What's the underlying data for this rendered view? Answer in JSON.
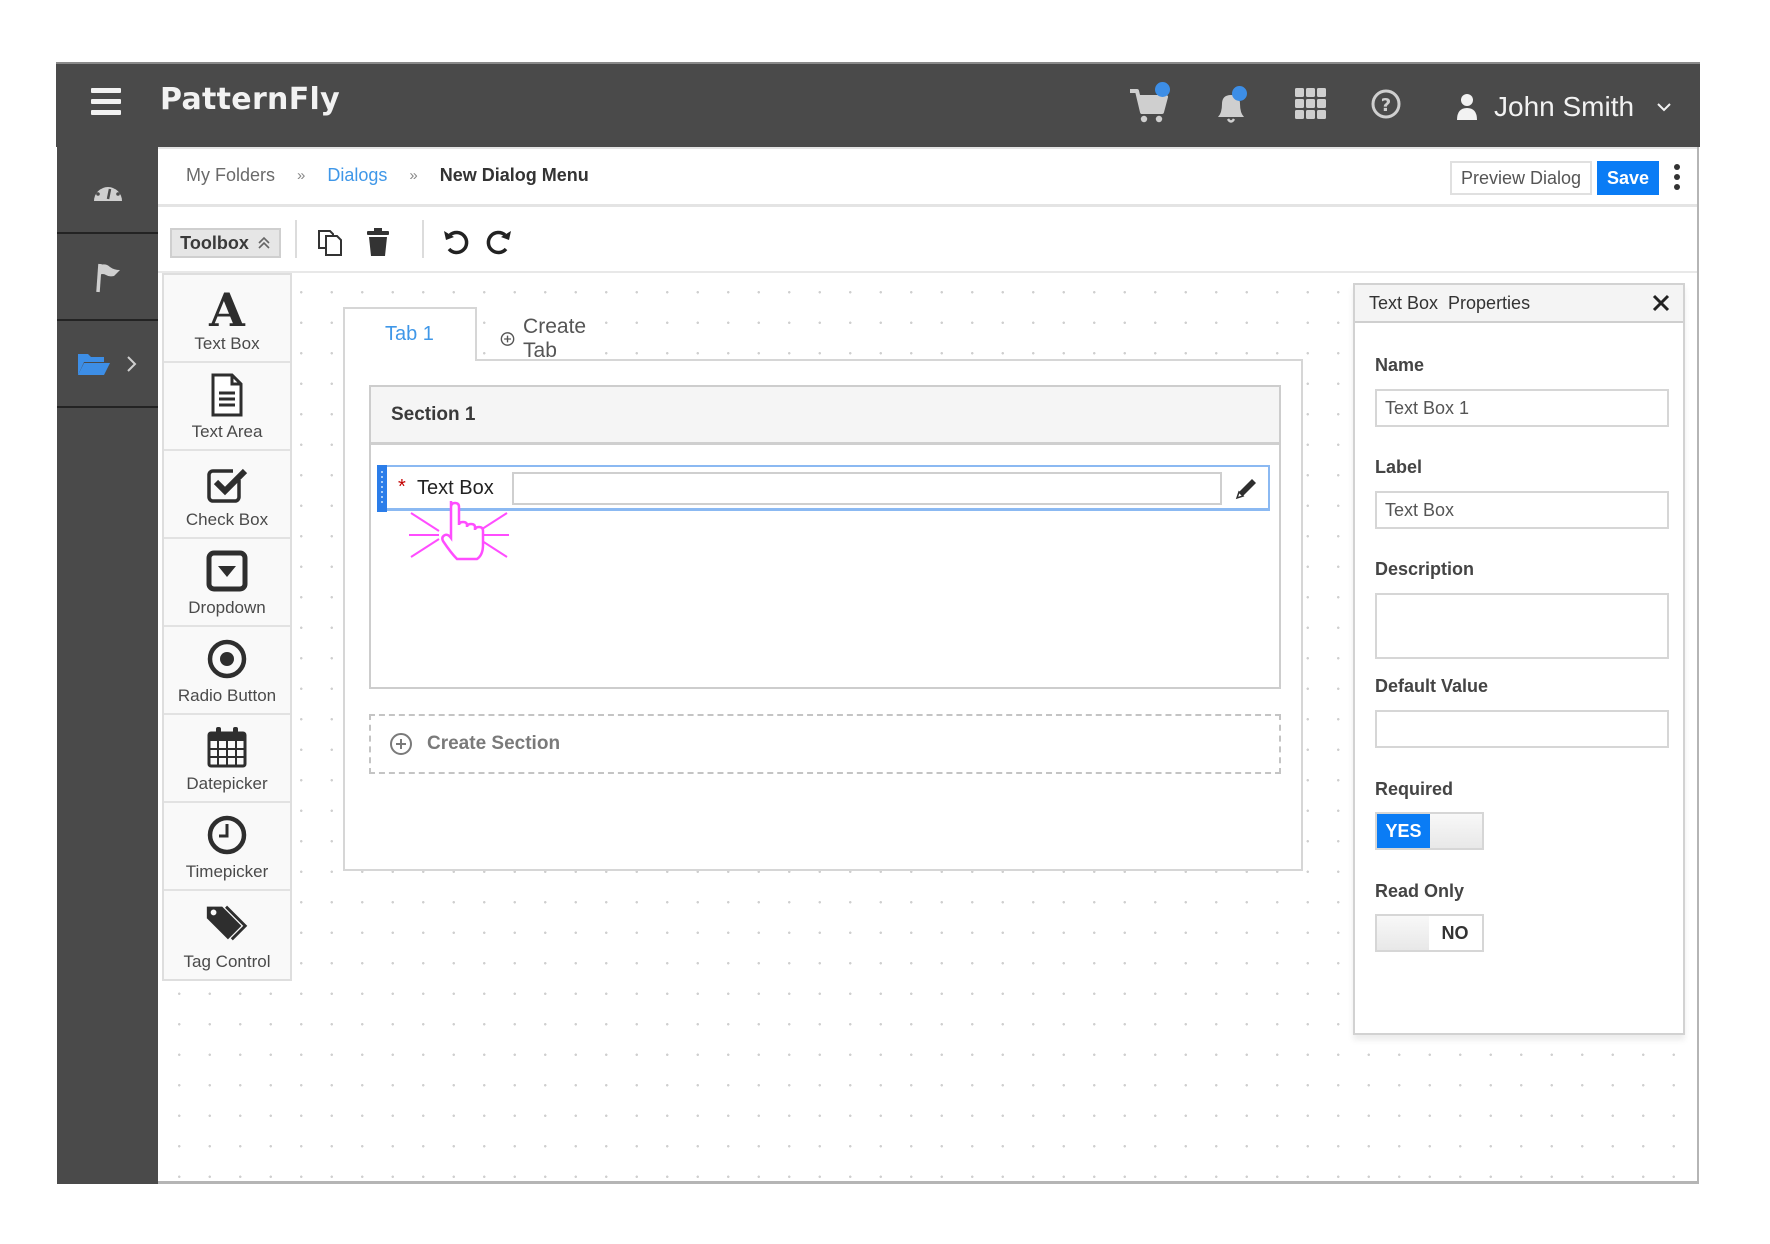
{
  "app": {
    "brand": "PatternFly",
    "user_name": "John Smith"
  },
  "header_icons": [
    {
      "name": "cart-icon",
      "has_badge": true
    },
    {
      "name": "bell-icon",
      "has_badge": true
    },
    {
      "name": "grid-icon",
      "has_badge": false
    },
    {
      "name": "help-icon",
      "has_badge": false
    }
  ],
  "colors": {
    "accent": "#0a7cf5",
    "link": "#3f97e8",
    "header_bg": "#4a4a4a",
    "badge": "#3d8ee6",
    "required": "#c40000",
    "cursor_highlight": "#ff33ff"
  },
  "sidebar": {
    "items": [
      {
        "icon": "dashboard-icon",
        "active": false
      },
      {
        "icon": "flag-icon",
        "active": false
      },
      {
        "icon": "folder-open-icon",
        "active": true,
        "has_submenu": true
      }
    ]
  },
  "breadcrumb": {
    "items": [
      "My Folders",
      "Dialogs",
      "New Dialog Menu"
    ],
    "separator": "»"
  },
  "actions": {
    "preview_label": "Preview Dialog",
    "save_label": "Save"
  },
  "toolbar": {
    "toolbox_label": "Toolbox"
  },
  "toolbox": {
    "items": [
      {
        "label": "Text Box",
        "icon": "text-box-icon"
      },
      {
        "label": "Text Area",
        "icon": "text-area-icon"
      },
      {
        "label": "Check Box",
        "icon": "check-box-icon"
      },
      {
        "label": "Dropdown",
        "icon": "dropdown-icon"
      },
      {
        "label": "Radio Button",
        "icon": "radio-button-icon"
      },
      {
        "label": "Datepicker",
        "icon": "datepicker-icon"
      },
      {
        "label": "Timepicker",
        "icon": "timepicker-icon"
      },
      {
        "label": "Tag Control",
        "icon": "tag-control-icon"
      }
    ]
  },
  "canvas": {
    "tabs": [
      {
        "label": "Tab 1",
        "active": true
      }
    ],
    "create_tab_label": "Create Tab",
    "section": {
      "title": "Section 1",
      "field": {
        "required_marker": "*",
        "label": "Text Box",
        "value": ""
      }
    },
    "create_section_label": "Create Section"
  },
  "properties": {
    "title": "Text Box  Properties",
    "fields": {
      "name_label": "Name",
      "name_value": "Text Box 1",
      "label_label": "Label",
      "label_value": "Text Box",
      "description_label": "Description",
      "description_value": "",
      "default_label": "Default Value",
      "default_value": "",
      "required_label": "Required",
      "required_state": "YES",
      "readonly_label": "Read Only",
      "readonly_state": "NO"
    }
  }
}
